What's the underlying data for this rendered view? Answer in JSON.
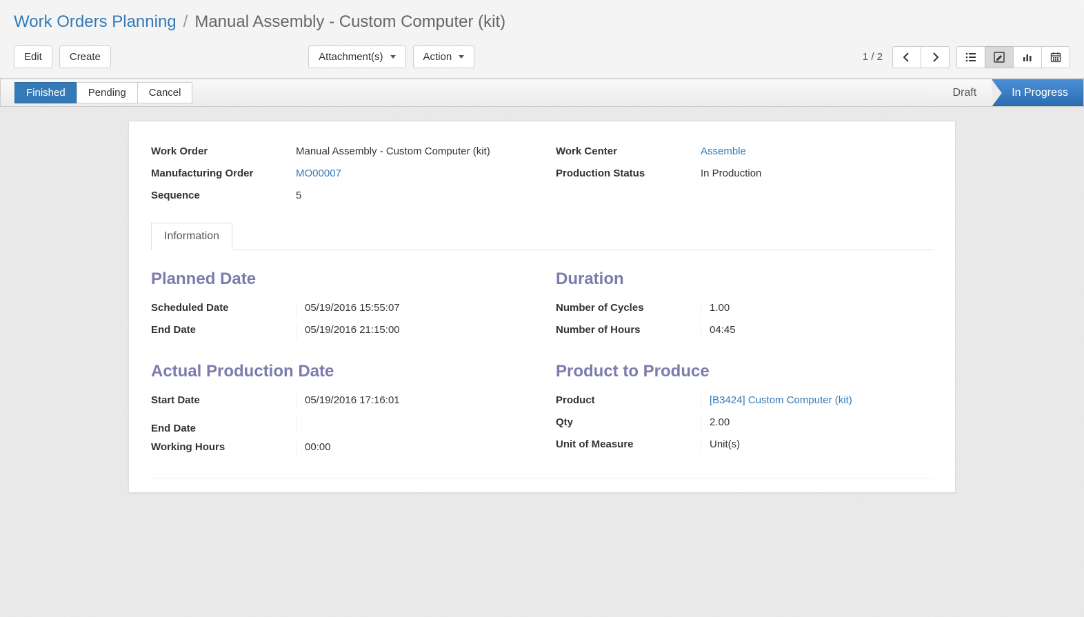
{
  "breadcrumb": {
    "root": "Work Orders Planning",
    "separator": "/",
    "current": "Manual Assembly - Custom Computer (kit)"
  },
  "toolbar": {
    "edit": "Edit",
    "create": "Create",
    "attachments": "Attachment(s)",
    "action": "Action",
    "pager": "1 / 2"
  },
  "statusbar": {
    "finished": "Finished",
    "pending": "Pending",
    "cancel": "Cancel",
    "draft": "Draft",
    "in_progress": "In Progress"
  },
  "top": {
    "labels": {
      "work_order": "Work Order",
      "manufacturing_order": "Manufacturing Order",
      "sequence": "Sequence",
      "work_center": "Work Center",
      "production_status": "Production Status"
    },
    "values": {
      "work_order": "Manual Assembly - Custom Computer (kit)",
      "manufacturing_order": "MO00007",
      "sequence": "5",
      "work_center": "Assemble",
      "production_status": "In Production"
    }
  },
  "tabs": {
    "information": "Information"
  },
  "sections": {
    "planned_date": "Planned Date",
    "duration": "Duration",
    "actual_production_date": "Actual Production Date",
    "product_to_produce": "Product to Produce"
  },
  "planned": {
    "labels": {
      "scheduled": "Scheduled Date",
      "end": "End Date"
    },
    "values": {
      "scheduled": "05/19/2016 15:55:07",
      "end": "05/19/2016 21:15:00"
    }
  },
  "duration": {
    "labels": {
      "cycles": "Number of Cycles",
      "hours": "Number of Hours"
    },
    "values": {
      "cycles": "1.00",
      "hours": "04:45"
    }
  },
  "actual": {
    "labels": {
      "start": "Start Date",
      "end": "End Date",
      "working_hours": "Working Hours"
    },
    "values": {
      "start": "05/19/2016 17:16:01",
      "end": "",
      "working_hours": "00:00"
    }
  },
  "product": {
    "labels": {
      "product": "Product",
      "qty": "Qty",
      "uom": "Unit of Measure"
    },
    "values": {
      "product": "[B3424] Custom Computer (kit)",
      "qty": "2.00",
      "uom": "Unit(s)"
    }
  }
}
